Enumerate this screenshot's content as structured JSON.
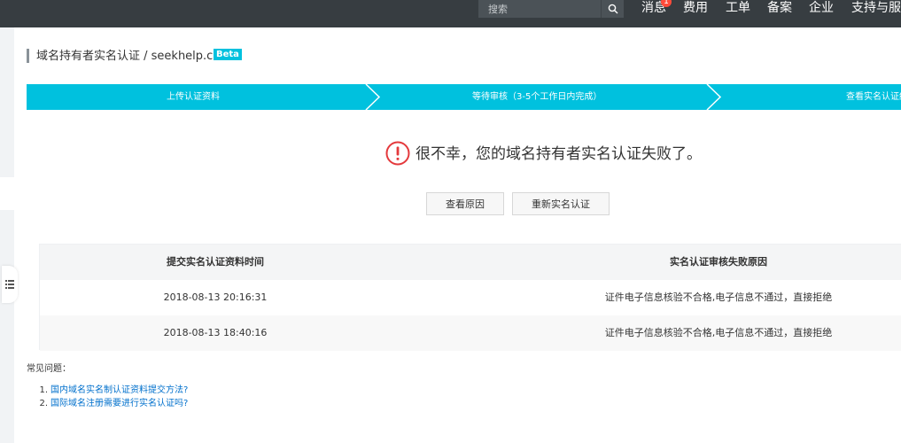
{
  "topbar": {
    "search": {
      "placeholder": "搜索",
      "value": ""
    },
    "nav": [
      {
        "label": "消息",
        "badge": "1"
      },
      {
        "label": "费用"
      },
      {
        "label": "工单"
      },
      {
        "label": "备案"
      },
      {
        "label": "企业"
      },
      {
        "label": "支持与服务"
      }
    ]
  },
  "header": {
    "title": "域名持有者实名认证 / seekhelp.cn",
    "beta": "Beta"
  },
  "steps": [
    {
      "label": "上传认证资料"
    },
    {
      "label": "等待审核（3-5个工作日内完成）"
    },
    {
      "label": "查看实名认证结果"
    }
  ],
  "result": {
    "message": "很不幸，您的域名持有者实名认证失败了。"
  },
  "actions": {
    "view_reason": "查看原因",
    "resubmit": "重新实名认证"
  },
  "table": {
    "columns": [
      "提交实名认证资料时间",
      "实名认证审核失败原因"
    ],
    "rows": [
      [
        "2018-08-13 20:16:31",
        "证件电子信息核验不合格,电子信息不通过，直接拒绝"
      ],
      [
        "2018-08-13 18:40:16",
        "证件电子信息核验不合格,电子信息不通过，直接拒绝"
      ]
    ]
  },
  "faq": {
    "title": "常见问题：",
    "items": [
      {
        "num": "1.",
        "text": "国内域名实名制认证资料提交方法?"
      },
      {
        "num": "2.",
        "text": "国际域名注册需要进行实名认证吗?"
      }
    ]
  },
  "colors": {
    "topbar": "#373d41",
    "accent": "#00c1de",
    "error": "#e4393c",
    "link": "#0070cc"
  }
}
